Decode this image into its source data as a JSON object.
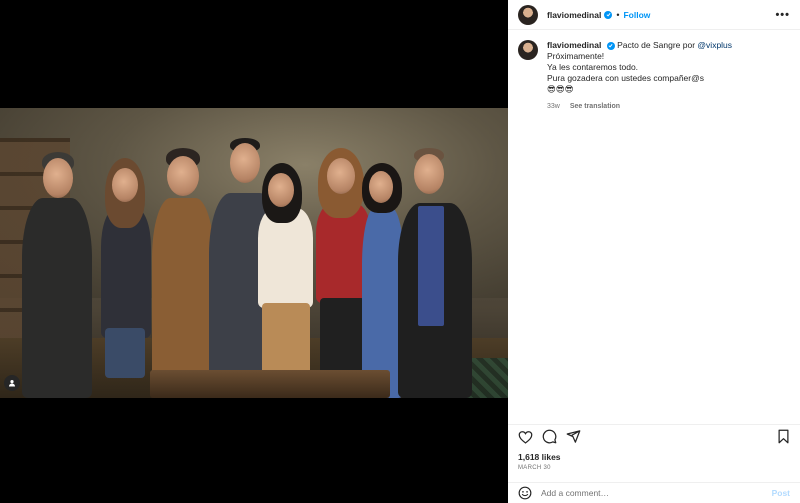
{
  "post": {
    "username": "flaviomedinal",
    "follow_label": "Follow",
    "more_label": "•••",
    "caption": {
      "username": "flaviomedinal",
      "intro": "Pacto de Sangre por ",
      "mention": "@vixplus",
      "lines": [
        "Próximamente!",
        "Ya les contaremos todo.",
        "Pura gozadera con ustedes compañer@s",
        "😎😎😎"
      ],
      "age": "33w",
      "translate_label": "See translation"
    },
    "likes": "1,618 likes",
    "date": "MARCH 30"
  },
  "comment_box": {
    "placeholder": "Add a comment…",
    "post_label": "Post"
  },
  "colors": {
    "accent": "#0095f6",
    "post_disabled": "#b3dbff",
    "text": "#262626",
    "muted": "#737373"
  },
  "icons": [
    "tag-people-icon",
    "verified-icon",
    "heart-icon",
    "comment-icon",
    "share-icon",
    "bookmark-icon",
    "emoji-icon"
  ]
}
